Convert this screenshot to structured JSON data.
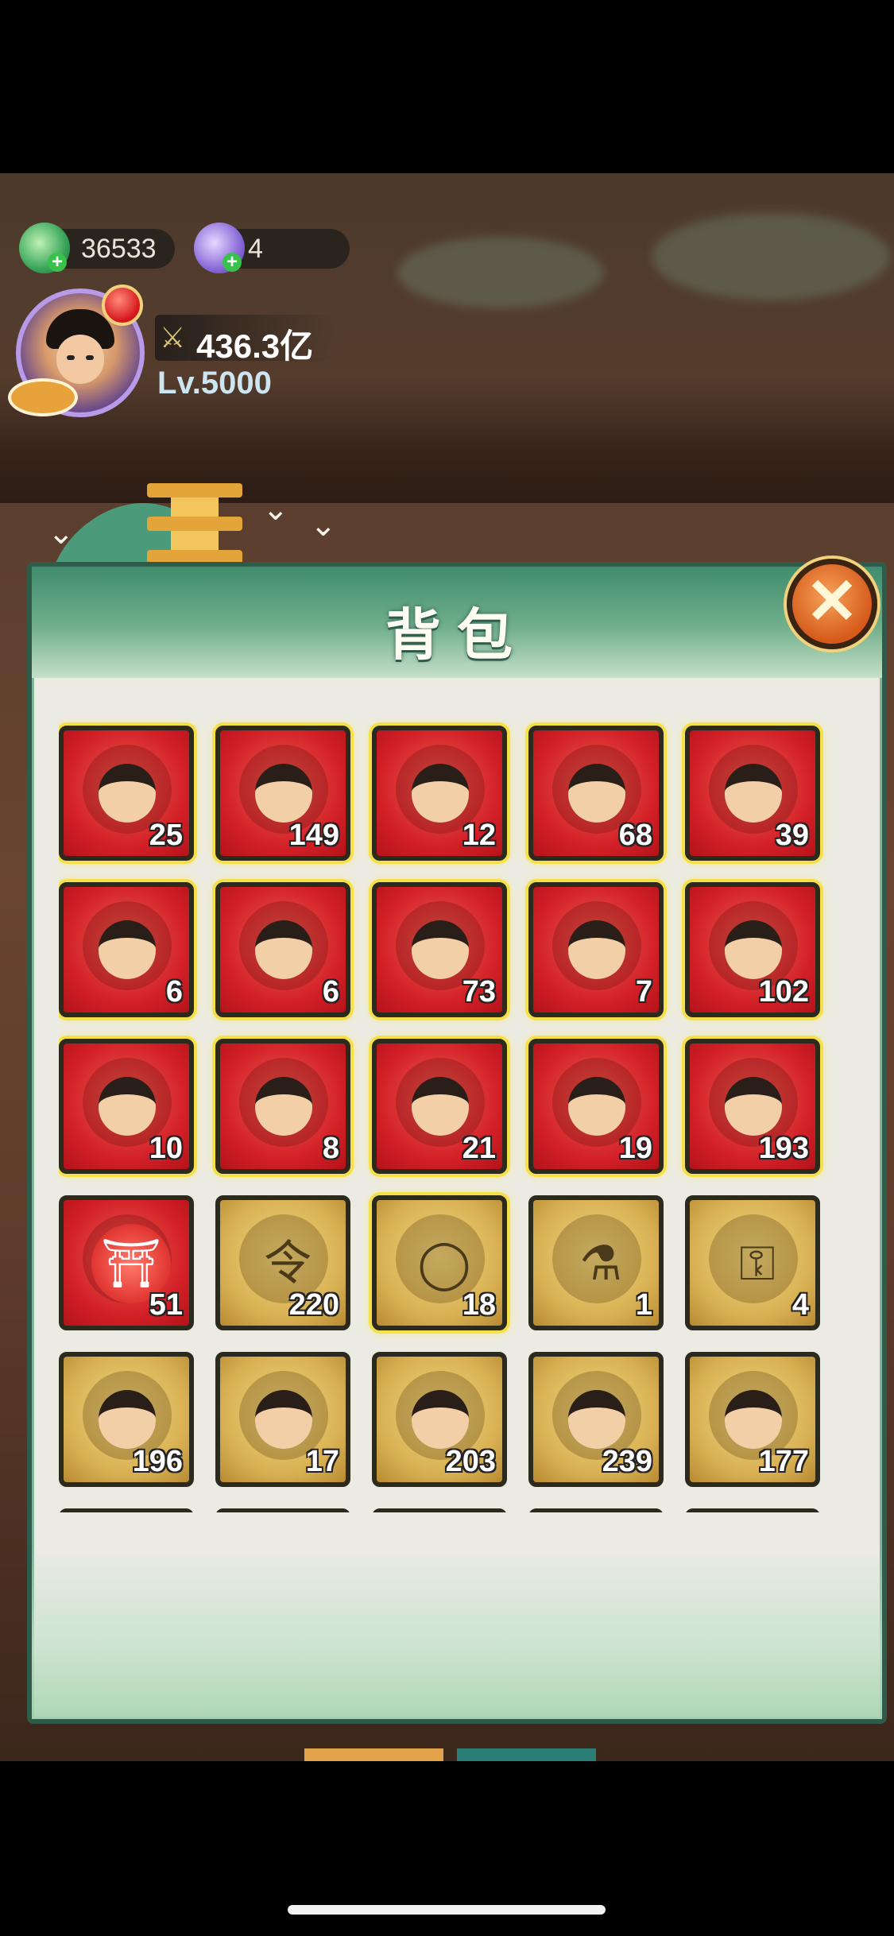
{
  "hud": {
    "currency1": "36533",
    "currency2": "4",
    "power": "436.3亿",
    "level": "Lv.5000"
  },
  "panel": {
    "title": "背包"
  },
  "inventory": [
    {
      "kind": "hero",
      "bg": "red",
      "glow": true,
      "count": "25"
    },
    {
      "kind": "hero",
      "bg": "red",
      "glow": true,
      "count": "149"
    },
    {
      "kind": "hero",
      "bg": "red",
      "glow": true,
      "count": "12"
    },
    {
      "kind": "hero",
      "bg": "red",
      "glow": true,
      "count": "68"
    },
    {
      "kind": "hero",
      "bg": "red",
      "glow": true,
      "count": "39"
    },
    {
      "kind": "hero",
      "bg": "red",
      "glow": true,
      "count": "6"
    },
    {
      "kind": "hero",
      "bg": "red",
      "glow": true,
      "count": "6"
    },
    {
      "kind": "hero",
      "bg": "red",
      "glow": true,
      "count": "73"
    },
    {
      "kind": "hero",
      "bg": "red",
      "glow": true,
      "count": "7"
    },
    {
      "kind": "hero",
      "bg": "red",
      "glow": true,
      "count": "102"
    },
    {
      "kind": "hero",
      "bg": "red",
      "glow": true,
      "count": "10"
    },
    {
      "kind": "hero",
      "bg": "red",
      "glow": true,
      "count": "8"
    },
    {
      "kind": "hero",
      "bg": "red",
      "glow": true,
      "count": "21"
    },
    {
      "kind": "hero",
      "bg": "red",
      "glow": true,
      "count": "19"
    },
    {
      "kind": "hero",
      "bg": "red",
      "glow": true,
      "count": "193"
    },
    {
      "kind": "item",
      "bg": "red",
      "glow": false,
      "count": "51",
      "icon": "token-icon",
      "glyph": "⛩"
    },
    {
      "kind": "item",
      "bg": "gold",
      "glow": false,
      "count": "220",
      "icon": "order-scroll-icon",
      "glyph": "令"
    },
    {
      "kind": "item",
      "bg": "gold",
      "glow": true,
      "count": "18",
      "icon": "jade-ring-icon",
      "glyph": "◯"
    },
    {
      "kind": "item",
      "bg": "gold",
      "glow": false,
      "count": "1",
      "icon": "potion-icon",
      "glyph": "⚗"
    },
    {
      "kind": "item",
      "bg": "gold",
      "glow": false,
      "count": "4",
      "icon": "key-icon",
      "glyph": "⚿"
    },
    {
      "kind": "hero",
      "bg": "gold",
      "glow": false,
      "count": "196"
    },
    {
      "kind": "hero",
      "bg": "gold",
      "glow": false,
      "count": "17"
    },
    {
      "kind": "hero",
      "bg": "gold",
      "glow": false,
      "count": "203"
    },
    {
      "kind": "hero",
      "bg": "gold",
      "glow": false,
      "count": "239"
    },
    {
      "kind": "hero",
      "bg": "gold",
      "glow": false,
      "count": "177"
    },
    {
      "kind": "hero",
      "bg": "gold",
      "glow": false,
      "count": ""
    },
    {
      "kind": "hero",
      "bg": "gold",
      "glow": false,
      "count": ""
    },
    {
      "kind": "hero",
      "bg": "gold",
      "glow": false,
      "count": ""
    },
    {
      "kind": "hero",
      "bg": "gold",
      "glow": false,
      "count": ""
    },
    {
      "kind": "hero",
      "bg": "gold",
      "glow": false,
      "count": ""
    }
  ],
  "colors": {
    "panel_green": "#3f8c6c",
    "slot_red": "#d21f27",
    "slot_gold": "#d8b052",
    "glow": "#f6e04a"
  }
}
